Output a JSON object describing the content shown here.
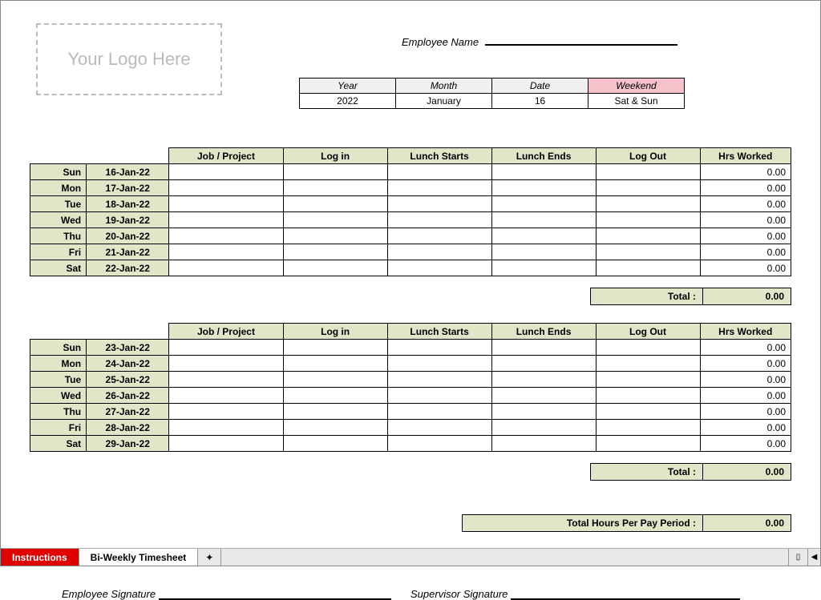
{
  "logo_placeholder": "Your Logo Here",
  "employee_name_label": "Employee Name",
  "meta": {
    "headers": {
      "year": "Year",
      "month": "Month",
      "date": "Date",
      "weekend": "Weekend"
    },
    "values": {
      "year": "2022",
      "month": "January",
      "date": "16",
      "weekend": "Sat & Sun"
    }
  },
  "columns": {
    "job": "Job / Project",
    "login": "Log in",
    "lunch_start": "Lunch Starts",
    "lunch_end": "Lunch Ends",
    "logout": "Log Out",
    "hrs": "Hrs Worked"
  },
  "week1": {
    "rows": [
      {
        "day": "Sun",
        "date": "16-Jan-22",
        "hrs": "0.00"
      },
      {
        "day": "Mon",
        "date": "17-Jan-22",
        "hrs": "0.00"
      },
      {
        "day": "Tue",
        "date": "18-Jan-22",
        "hrs": "0.00"
      },
      {
        "day": "Wed",
        "date": "19-Jan-22",
        "hrs": "0.00"
      },
      {
        "day": "Thu",
        "date": "20-Jan-22",
        "hrs": "0.00"
      },
      {
        "day": "Fri",
        "date": "21-Jan-22",
        "hrs": "0.00"
      },
      {
        "day": "Sat",
        "date": "22-Jan-22",
        "hrs": "0.00"
      }
    ],
    "total_label": "Total :",
    "total": "0.00"
  },
  "week2": {
    "rows": [
      {
        "day": "Sun",
        "date": "23-Jan-22",
        "hrs": "0.00"
      },
      {
        "day": "Mon",
        "date": "24-Jan-22",
        "hrs": "0.00"
      },
      {
        "day": "Tue",
        "date": "25-Jan-22",
        "hrs": "0.00"
      },
      {
        "day": "Wed",
        "date": "26-Jan-22",
        "hrs": "0.00"
      },
      {
        "day": "Thu",
        "date": "27-Jan-22",
        "hrs": "0.00"
      },
      {
        "day": "Fri",
        "date": "28-Jan-22",
        "hrs": "0.00"
      },
      {
        "day": "Sat",
        "date": "29-Jan-22",
        "hrs": "0.00"
      }
    ],
    "total_label": "Total :",
    "total": "0.00"
  },
  "grand": {
    "label": "Total Hours Per Pay Period :",
    "value": "0.00"
  },
  "signatures": {
    "employee": "Employee Signature",
    "supervisor": "Supervisor Signature"
  },
  "tabs": {
    "instructions": "Instructions",
    "timesheet": "Bi-Weekly Timesheet",
    "new_icon": "✦",
    "scroll_arrow": "◀"
  }
}
